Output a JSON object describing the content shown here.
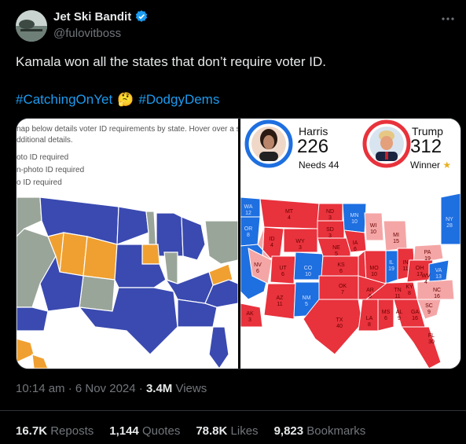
{
  "author": {
    "name": "Jet Ski Bandit",
    "handle": "@fulovitboss"
  },
  "menu_icon": "more-dots",
  "post": {
    "text": "Kamala won all the states that don’t require voter ID.",
    "hashtag1": "#CatchingOnYet",
    "emoji": "🤔",
    "hashtag2": "#DodgyDems"
  },
  "left_image": {
    "line1": "nap below details voter ID requirements by state. Hover over a st",
    "line2": "dditional details.",
    "legend1": "oto ID required",
    "legend2": "n-photo ID required",
    "legend3": "o ID required",
    "colors": {
      "photo": "#3a4ab0",
      "nonphoto": "#f0a030",
      "none": "#9aa59a"
    }
  },
  "right_image": {
    "harris_name": "Harris",
    "harris_votes": "226",
    "harris_sub": "Needs 44",
    "trump_name": "Trump",
    "trump_votes": "312",
    "trump_sub": "Winner",
    "states": {
      "wa": "WA\n12",
      "or": "OR\n8",
      "mt": "MT\n4",
      "nd": "ND\n3",
      "mn": "MN\n10",
      "id": "ID\n4",
      "wy": "WY\n3",
      "sd": "SD\n3",
      "wi": "WI\n10",
      "mi": "MI\n15",
      "ny": "NY\n28",
      "nv": "NV\n6",
      "ut": "UT\n6",
      "co": "CO\n10",
      "ne": "NE\n5",
      "ia": "IA\n6",
      "il": "IL\n19",
      "in": "IN\n11",
      "oh": "OH\n17",
      "pa": "PA\n19",
      "ks": "KS\n6",
      "mo": "MO\n10",
      "ky": "KY\n8",
      "wv": "WV\n4",
      "va": "VA\n13",
      "az": "AZ\n11",
      "nm": "NM\n5",
      "ok": "OK\n7",
      "ar": "AR\n6",
      "tn": "TN\n11",
      "nc": "NC\n16",
      "sc": "SC\n9",
      "ga": "GA\n16",
      "al": "AL\n9",
      "ms": "MS\n6",
      "la": "LA\n8",
      "tx": "TX\n40",
      "fl": "FL\n30",
      "ak": "AK\n3"
    },
    "colors": {
      "rep": "#e8323c",
      "rep_light": "#f4a6a6",
      "dem": "#1e6fe0",
      "dem_light": "#9cc0f0"
    }
  },
  "meta": {
    "time": "10:14 am · 6 Nov 2024 · ",
    "views_num": "3.4M",
    "views_label": " Views"
  },
  "stats": {
    "reposts_num": "16.7K",
    "reposts_label": "Reposts",
    "quotes_num": "1,144",
    "quotes_label": "Quotes",
    "likes_num": "78.8K",
    "likes_label": "Likes",
    "bookmarks_num": "9,823",
    "bookmarks_label": "Bookmarks"
  }
}
